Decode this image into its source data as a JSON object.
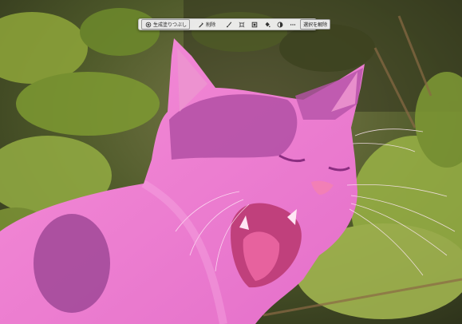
{
  "toolbar": {
    "generative_fill_label": "生成塗りつぶし",
    "delete_label": "削除",
    "deselect_label": "選択を解除",
    "icons": [
      "generative-fill-icon",
      "brush-icon",
      "subtract-brush-icon",
      "transform-icon",
      "mask-icon",
      "fill-icon",
      "adjustment-icon",
      "more-icon"
    ]
  },
  "colors": {
    "selection_overlay": "#f07ad6",
    "toolbar_bg": "#f2f2f2"
  }
}
